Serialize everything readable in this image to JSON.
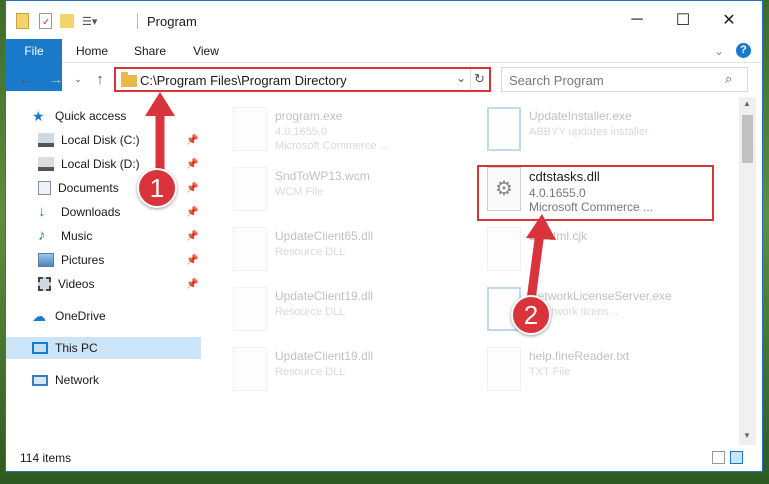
{
  "window": {
    "title": "Program",
    "minimize": "─",
    "maximize": "☐",
    "close": "✕"
  },
  "ribbon": {
    "tabs": [
      {
        "label": "File"
      },
      {
        "label": "Home"
      },
      {
        "label": "Share"
      },
      {
        "label": "View"
      }
    ],
    "help": "?",
    "expand": "⌄"
  },
  "address": {
    "path": "C:\\Program Files\\Program Directory",
    "dropdown": "⌄",
    "refresh": "↻"
  },
  "search": {
    "placeholder": "Search Program",
    "icon": "search-icon"
  },
  "sidebar": {
    "items": [
      {
        "label": "Quick access",
        "icon": "star-icon"
      },
      {
        "label": "Local Disk (C:)",
        "icon": "drive-icon",
        "pinned": true
      },
      {
        "label": "Local Disk (D:)",
        "icon": "drive-icon",
        "pinned": true
      },
      {
        "label": "Documents",
        "icon": "documents-icon",
        "pinned": true
      },
      {
        "label": "Downloads",
        "icon": "downloads-icon",
        "pinned": true
      },
      {
        "label": "Music",
        "icon": "music-icon",
        "pinned": true
      },
      {
        "label": "Pictures",
        "icon": "pictures-icon",
        "pinned": true
      },
      {
        "label": "Videos",
        "icon": "videos-icon",
        "pinned": true
      },
      {
        "label": "OneDrive",
        "icon": "cloud-icon"
      },
      {
        "label": "This PC",
        "icon": "computer-icon"
      },
      {
        "label": "Network",
        "icon": "network-icon"
      }
    ]
  },
  "files": [
    {
      "name": "program.exe",
      "line1": "4.0.1655.0",
      "line2": "Microsoft Commerce ..."
    },
    {
      "name": "UpdateInstaller.exe",
      "line1": "ABBYY updates installer",
      "line2": ""
    },
    {
      "name": "SndToWP13.wcm",
      "line1": "WCM File",
      "line2": ""
    },
    {
      "name": "cdtstasks.dll",
      "line1": "4.0.1655.0",
      "line2": "Microsoft Commerce ..."
    },
    {
      "name": "UpdateClient65.dll",
      "line1": "Resource DLL",
      "line2": ""
    },
    {
      "name": "LDHtml.cjk",
      "line1": "",
      "line2": ""
    },
    {
      "name": "UpdateClient19.dll",
      "line1": "Resource DLL",
      "line2": ""
    },
    {
      "name": "NetworkLicenseServer.exe",
      "line1": "Y network licens...",
      "line2": ""
    },
    {
      "name": "UpdateClient19.dll",
      "line1": "Resource DLL",
      "line2": ""
    },
    {
      "name": "help.fineReader.txt",
      "line1": "TXT File",
      "line2": ""
    }
  ],
  "status": {
    "count": "114 items"
  },
  "annotations": {
    "step1": "1",
    "step2": "2"
  }
}
